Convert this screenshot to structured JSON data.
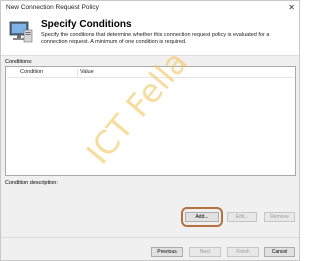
{
  "window": {
    "title": "New Connection Request Policy",
    "close_glyph": "✕"
  },
  "header": {
    "heading": "Specify Conditions",
    "description": "Specify the conditions that determine whether this connection request policy is evaluated for a connection request. A minimum of one condition is required.",
    "icon": "computer-network-icon"
  },
  "conditions": {
    "label": "Conditions:",
    "columns": [
      "Condition",
      "Value"
    ],
    "rows": []
  },
  "condition_description": {
    "label": "Condition description:",
    "text": ""
  },
  "buttons": {
    "add": "Add...",
    "edit": "Edit...",
    "remove": "Remove",
    "previous": "Previous",
    "next": "Next",
    "finish": "Finish",
    "cancel": "Cancel"
  },
  "watermark": "ICT Fella",
  "colors": {
    "highlight": "#b5713f",
    "watermark": "#f2c14e"
  }
}
